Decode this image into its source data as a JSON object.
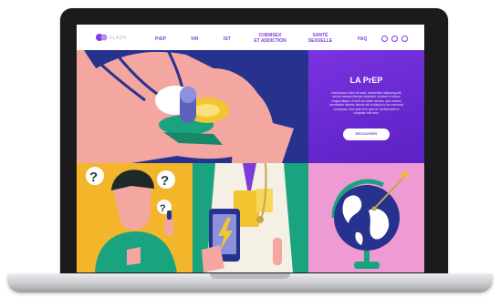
{
  "nav": {
    "logo_text": "FLASH",
    "items": [
      "PrEP",
      "VIH",
      "IST",
      "CHEMSEX\nET ADDICTION",
      "SANTÉ\nSEXUELLE",
      "FAQ"
    ]
  },
  "feature": {
    "title": "LA PrEP",
    "body": "Lorem ipsum dolor sit amet, consectetur adipiscing elit, sed do eiusmod tempor incididunt ut labore et dolore magna aliqua. Ut enim ad minim veniam, quis nostrud exercitation ullamco laboris nisi ut aliquip ex ea commodo consequat. Duis aute irure dolor in reprehenderit in voluptate velit esse.",
    "cta_label": "DÉCOUVRIR"
  },
  "colors": {
    "hero_bg": "#27328e",
    "feature_bg": "#6a2bd6",
    "tile_yellow": "#f3b62a",
    "tile_green": "#1aa37f",
    "tile_pink": "#ef9bd3"
  },
  "icons": [
    "logo-icon",
    "facebook-icon",
    "twitter-icon",
    "instagram-icon"
  ]
}
